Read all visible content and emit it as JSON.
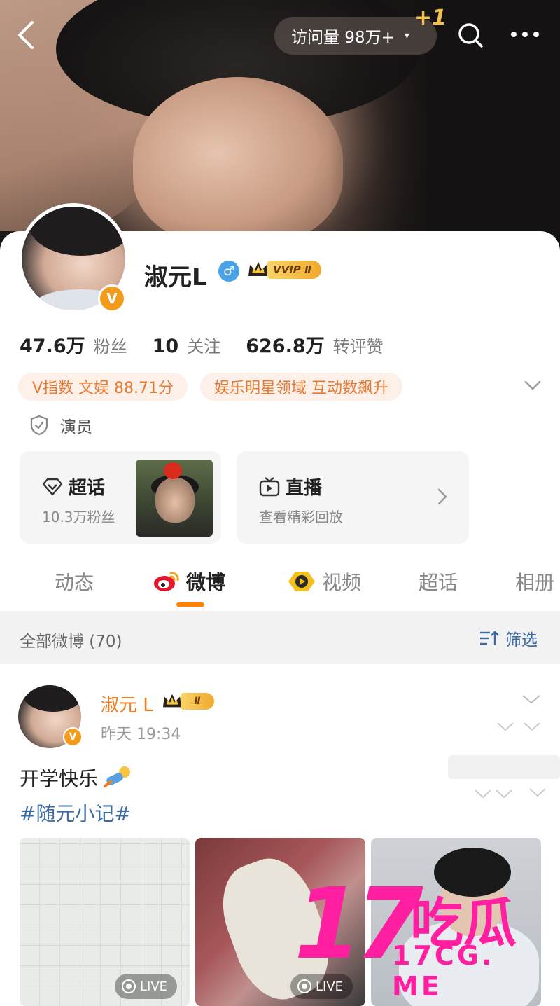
{
  "header": {
    "back_icon": "chevron-left-icon",
    "visits_label": "访问量 98万+",
    "visits_caret": "▾",
    "plus_one": "+1",
    "search_icon": "search-icon",
    "more_icon": "more-horizontal-icon"
  },
  "profile": {
    "name": "淑元L",
    "verified_badge": "V",
    "gender_icon": "♂",
    "vip_label": "VVIP Ⅱ",
    "stats": [
      {
        "num": "47.6万",
        "label": "粉丝"
      },
      {
        "num": "10",
        "label": "关注"
      },
      {
        "num": "626.8万",
        "label": "转评赞"
      }
    ],
    "chips": [
      "V指数 文娱 88.71分",
      "娱乐明星领域 互动数飙升"
    ],
    "role": "演员"
  },
  "panels": {
    "supertopic": {
      "title": "超话",
      "sub": "10.3万粉丝"
    },
    "live": {
      "title": "直播",
      "sub": "查看精彩回放"
    }
  },
  "tabs": [
    "动态",
    "微博",
    "视频",
    "超话",
    "相册"
  ],
  "active_tab": "微博",
  "filter": {
    "all_label": "全部微博 (70)",
    "filter_label": "筛选"
  },
  "post": {
    "author": "淑元 L",
    "badge": "Ⅱ",
    "time": "昨天 19:34",
    "text": "开学快乐",
    "hashtag": "#随元小记#",
    "live_label": "LIVE"
  },
  "watermark": {
    "big": "17",
    "cn": "吃瓜",
    "url": "17CG. ME"
  },
  "colors": {
    "accent": "#ff8200",
    "link": "#3b6aa8",
    "name_orange": "#f07c1d",
    "watermark": "#ff1fa0"
  }
}
